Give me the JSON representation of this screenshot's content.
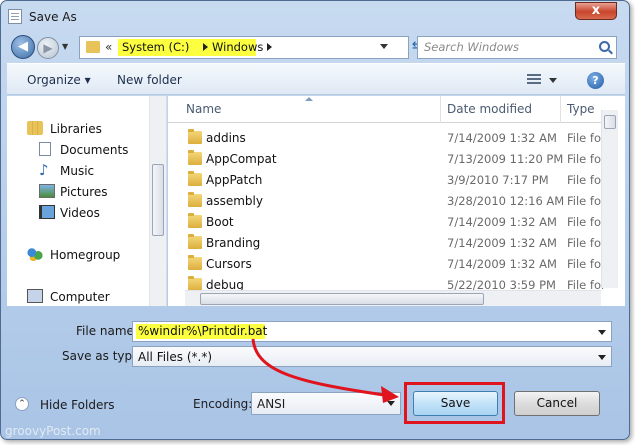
{
  "window": {
    "title": "Save As",
    "close_label": "x"
  },
  "address": {
    "crumbs": [
      "System (C:)",
      "Windows"
    ],
    "overflow": "«"
  },
  "search": {
    "placeholder": "Search Windows"
  },
  "toolbar": {
    "organize": "Organize ▾",
    "new_folder": "New folder"
  },
  "sidebar": {
    "items": [
      {
        "label": "Libraries",
        "icon": "libraries-icon"
      },
      {
        "label": "Documents",
        "icon": "documents-icon"
      },
      {
        "label": "Music",
        "icon": "music-icon"
      },
      {
        "label": "Pictures",
        "icon": "pictures-icon"
      },
      {
        "label": "Videos",
        "icon": "videos-icon"
      },
      {
        "label": "Homegroup",
        "icon": "homegroup-icon"
      },
      {
        "label": "Computer",
        "icon": "computer-icon"
      }
    ]
  },
  "columns": {
    "name": "Name",
    "date": "Date modified",
    "type": "Type"
  },
  "files": [
    {
      "name": "addins",
      "date": "7/14/2009 1:32 AM",
      "type": "File fol"
    },
    {
      "name": "AppCompat",
      "date": "7/13/2009 11:20 PM",
      "type": "File fol"
    },
    {
      "name": "AppPatch",
      "date": "3/9/2010 7:17 PM",
      "type": "File fol"
    },
    {
      "name": "assembly",
      "date": "3/28/2010 12:16 AM",
      "type": "File fol"
    },
    {
      "name": "Boot",
      "date": "7/14/2009 1:32 AM",
      "type": "File fol"
    },
    {
      "name": "Branding",
      "date": "7/14/2009 1:32 AM",
      "type": "File fol"
    },
    {
      "name": "Cursors",
      "date": "7/14/2009 1:32 AM",
      "type": "File fol"
    },
    {
      "name": "debug",
      "date": "5/22/2010 3:59 PM",
      "type": "File fol"
    }
  ],
  "form": {
    "file_name_label": "File name:",
    "file_name_value": "%windir%\\Printdir.bat",
    "save_type_label": "Save as type:",
    "save_type_value": "All Files  (*.*)",
    "encoding_label": "Encoding:",
    "encoding_value": "ANSI"
  },
  "buttons": {
    "hide_folders": "Hide Folders",
    "save": "Save",
    "cancel": "Cancel"
  },
  "watermark": "groovyPost.com",
  "colors": {
    "highlight": "#fbff40",
    "callout": "#e0141c"
  }
}
